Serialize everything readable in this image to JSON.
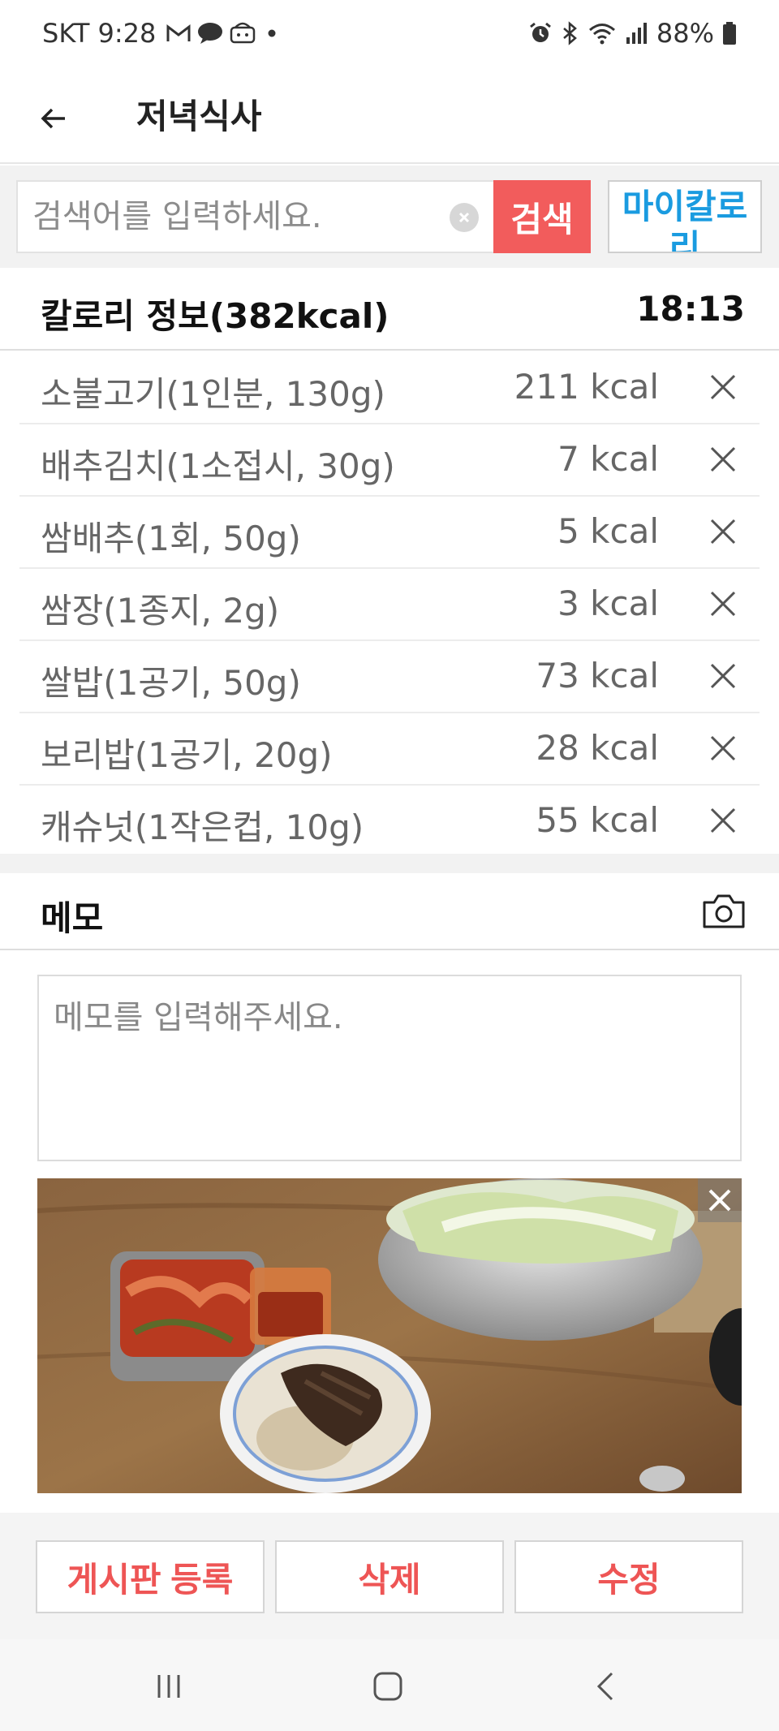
{
  "status_bar": {
    "carrier_time": "SKT 9:28",
    "battery": "88%",
    "left_icons": [
      "gmail-icon",
      "chat-icon",
      "app-icon",
      "dot-icon"
    ],
    "right_icons": [
      "alarm-icon",
      "bluetooth-icon",
      "wifi-icon",
      "signal-icon",
      "battery-icon"
    ]
  },
  "app_bar": {
    "title": "저녁식사",
    "back_icon": "back-arrow-icon"
  },
  "search": {
    "placeholder": "검색어를 입력하세요.",
    "button_label": "검색",
    "my_calorie_label": "마이칼로리"
  },
  "calorie_info": {
    "title": "칼로리 정보(382kcal)",
    "time": "18:13"
  },
  "foods": [
    {
      "name": "소불고기(1인분, 130g)",
      "kcal": "211 kcal"
    },
    {
      "name": "배추김치(1소접시, 30g)",
      "kcal": "7 kcal"
    },
    {
      "name": "쌈배추(1회, 50g)",
      "kcal": "5 kcal"
    },
    {
      "name": "쌈장(1종지, 2g)",
      "kcal": "3 kcal"
    },
    {
      "name": "쌀밥(1공기, 50g)",
      "kcal": "73 kcal"
    },
    {
      "name": "보리밥(1공기, 20g)",
      "kcal": "28 kcal"
    },
    {
      "name": "캐슈넛(1작은컵, 10g)",
      "kcal": "55 kcal"
    }
  ],
  "memo": {
    "title": "메모",
    "placeholder": "메모를 입력해주세요.",
    "camera_icon": "camera-icon"
  },
  "actions": {
    "board": "게시판 등록",
    "delete": "삭제",
    "edit": "수정"
  },
  "colors": {
    "accent_red": "#f25c5c",
    "action_text_red": "#ee5555",
    "link_blue": "#1a9be0"
  },
  "nav": [
    "recent-apps-icon",
    "home-icon",
    "back-icon"
  ]
}
